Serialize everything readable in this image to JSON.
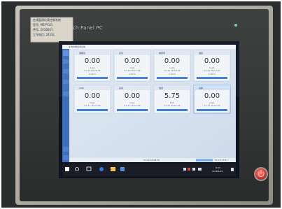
{
  "sticker": {
    "line1": "在线监测仪表控制系统",
    "line2": "型号: MS-PC01",
    "line3": "序号: 2018001",
    "line4": "工作电压: 24Vdc"
  },
  "bezel": {
    "brand": "ch Panel PC"
  },
  "app": {
    "window_title": "在线水质监测系统",
    "tiles": [
      {
        "header": "溶解氧",
        "value": "0.00",
        "unit": "mg/L",
        "time": "01-29 04:28:56",
        "status": "0.00°C"
      },
      {
        "header": "总氮",
        "value": "0.00",
        "unit": "mg/L",
        "time": "01-29 08:27:56",
        "status": "0.00°C"
      },
      {
        "header": "电导率",
        "value": "0.00",
        "unit": "mg/L",
        "time": "01-29 08:28:56",
        "status": "0.00°C"
      },
      {
        "header": "浊度",
        "value": "0.00",
        "unit": "mg/L",
        "time": "01-29 08:12:03",
        "status": "0.00°C"
      },
      {
        "header": "COD",
        "value": "0.00",
        "unit": "mg/L",
        "time": "01-27 16:27:56",
        "status": ""
      },
      {
        "header": "氨氮",
        "value": "0.00",
        "unit": "mg/L",
        "time": "01-27 16:27:56",
        "status": ""
      },
      {
        "header": "浊度",
        "value": "5.75",
        "unit": "NTU",
        "time": "01-27 16:27:56",
        "status": ""
      },
      {
        "header": "总磷",
        "value": "0.00",
        "unit": "mg/L",
        "time": "01-27 16:27:56",
        "status": ""
      }
    ],
    "status_bar": {
      "left": "01-29 04:28:56",
      "right": "01-29 13:23"
    }
  },
  "taskbar": {
    "time": "8:04",
    "date": "2018/1/29"
  },
  "colors": {
    "accent_blue": "#3f7fd8",
    "app_bg": "#dbe6f3",
    "tile_bg": "#f2f5f8",
    "power_button": "#e5483f"
  }
}
